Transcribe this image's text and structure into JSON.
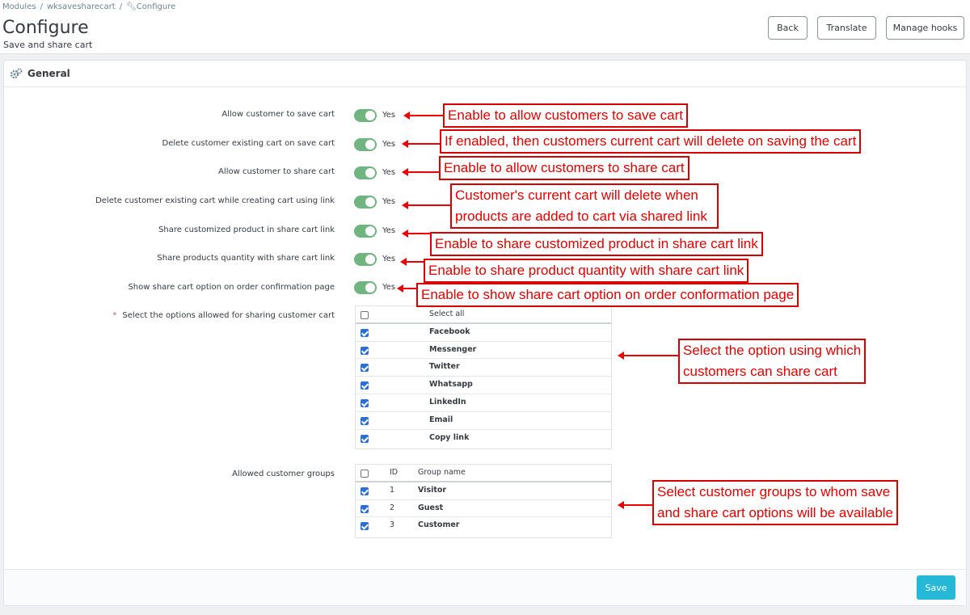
{
  "breadcrumb": {
    "items": [
      "Modules",
      "wksavesharecart"
    ],
    "current": "Configure"
  },
  "page": {
    "title": "Configure",
    "subtitle": "Save and share cart"
  },
  "toolbar": {
    "back": "Back",
    "translate": "Translate",
    "manage_hooks": "Manage hooks"
  },
  "panel": {
    "title": "General",
    "save_label": "Save"
  },
  "settings": [
    {
      "label": "Allow customer to save cart",
      "value": "Yes"
    },
    {
      "label": "Delete customer existing cart on save cart",
      "value": "Yes"
    },
    {
      "label": "Allow customer to share cart",
      "value": "Yes"
    },
    {
      "label": "Delete customer existing cart while creating cart using link",
      "value": "Yes"
    },
    {
      "label": "Share customized product in share cart link",
      "value": "Yes"
    },
    {
      "label": "Share products quantity with share cart link",
      "value": "Yes"
    },
    {
      "label": "Show share cart option on order confirmation page",
      "value": "Yes"
    }
  ],
  "share_options": {
    "label": "Select the options allowed for sharing customer cart",
    "required_mark": "*",
    "select_all": "Select all",
    "items": [
      "Facebook",
      "Messenger",
      "Twitter",
      "Whatsapp",
      "LinkedIn",
      "Email",
      "Copy link"
    ]
  },
  "customer_groups": {
    "label": "Allowed customer groups",
    "columns": [
      "ID",
      "Group name"
    ],
    "rows": [
      {
        "id": "1",
        "name": "Visitor"
      },
      {
        "id": "2",
        "name": "Guest"
      },
      {
        "id": "3",
        "name": "Customer"
      }
    ]
  },
  "annotations": [
    "Enable to allow customers to save cart",
    "If enabled, then customers current cart will delete on saving the cart",
    "Enable to allow customers to share cart",
    "Customer's current cart will delete when",
    "products are added to cart via shared link",
    "Enable to share customized product in share cart link",
    "Enable to share product quantity with share cart link",
    "Enable to show share cart option on order conformation page",
    "Select the option using which",
    "customers can share cart",
    "Select customer groups to whom save",
    "and share cart options will be available"
  ],
  "colors": {
    "switch_on": "#70b580",
    "save_button": "#25b9d7",
    "annotation": "#e00000",
    "checkbox": "#2b6fd6"
  }
}
